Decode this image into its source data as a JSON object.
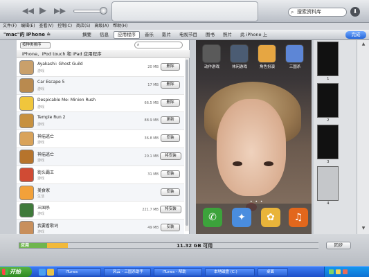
{
  "window": {
    "title_icon": "apple-logo"
  },
  "transport": {
    "prev": "◀◀",
    "play": "▶",
    "next": "▶▶"
  },
  "search": {
    "placeholder": "搜索资料库"
  },
  "menubar": [
    "文件(F)",
    "编辑(E)",
    "查看(V)",
    "控制(C)",
    "商店(S)",
    "高级(A)",
    "帮助(H)"
  ],
  "device": {
    "name": "\"mac\"的 iPhone ≐",
    "tabs": [
      "摘要",
      "信息",
      "应用程序",
      "音乐",
      "影片",
      "电视节目",
      "图书",
      "照片",
      "此 iPhone 上"
    ],
    "selected_tab": "应用程序",
    "done_label": "完成"
  },
  "apps_panel": {
    "sort_label": "按种类排序",
    "header": "iPhone、iPod touch 和 iPad 应用程序",
    "apps": [
      {
        "name": "Ayakashi: Ghost Guild",
        "category": "游戏",
        "size": "20 MB",
        "action": "删除",
        "color": "#c9a06b"
      },
      {
        "name": "Car Escape 5",
        "category": "游戏",
        "size": "17 MB",
        "action": "删除",
        "color": "#b98a4f"
      },
      {
        "name": "Despicable Me: Minion Rush",
        "category": "游戏",
        "size": "66.5 MB",
        "action": "删除",
        "color": "#f0c63c"
      },
      {
        "name": "Temple Run 2",
        "category": "游戏",
        "size": "88.9 MB",
        "action": "更新",
        "color": "#c7913f"
      },
      {
        "name": "神庙逃亡",
        "category": "游戏",
        "size": "36.8 MB",
        "action": "安装",
        "color": "#d9a35a"
      },
      {
        "name": "神庙逃亡",
        "category": "游戏",
        "size": "20.1 MB",
        "action": "将安装",
        "color": "#b6742c"
      },
      {
        "name": "街头霸王",
        "category": "游戏",
        "size": "31 MB",
        "action": "安装",
        "color": "#d04b34"
      },
      {
        "name": "美食家",
        "category": "生活",
        "size": "",
        "action": "安装",
        "color": "#f2a13a"
      },
      {
        "name": "三国杀",
        "category": "游戏",
        "size": "221.7 MB",
        "action": "将安装",
        "color": "#3f7a3a"
      },
      {
        "name": "我要看歌词",
        "category": "游戏",
        "size": "49 MB",
        "action": "安装",
        "color": "#c88f5c"
      }
    ]
  },
  "home_screen": {
    "icons": [
      {
        "label": "动作游戏",
        "color": "#5a5a5a"
      },
      {
        "label": "休闲游戏",
        "color": "#4b5c73"
      },
      {
        "label": "角色扮演",
        "color": "#e6a642"
      },
      {
        "label": "三国杀",
        "color": "#5d86d6"
      }
    ],
    "dock": [
      {
        "name": "phone-app",
        "glyph": "✆",
        "color": "#3ca33b"
      },
      {
        "name": "safari-app",
        "glyph": "✦",
        "color": "#4a8ddf"
      },
      {
        "name": "photos-app",
        "glyph": "✿",
        "color": "#e9b43a"
      },
      {
        "name": "music-app",
        "glyph": "♫",
        "color": "#e2671c"
      }
    ],
    "page_dots": "• • •"
  },
  "page_thumbs": [
    "1",
    "2",
    "3",
    "4"
  ],
  "capacity": {
    "apps_label": "应用",
    "free_label": "11.32 GB 可用",
    "colors": {
      "apps": "#6fb54e",
      "other": "#f1b93a"
    }
  },
  "sync_label": "同步",
  "taskbar": {
    "start": "开始",
    "tasks": [
      {
        "label": "iTunes",
        "active": false
      },
      {
        "label": "风云 - 三国杀助手",
        "active": false
      },
      {
        "label": "iTunes - 帮助",
        "active": false
      },
      {
        "label": "本地磁盘 (C:)",
        "active": false
      },
      {
        "label": "桌面",
        "active": false
      }
    ],
    "clock": ""
  }
}
